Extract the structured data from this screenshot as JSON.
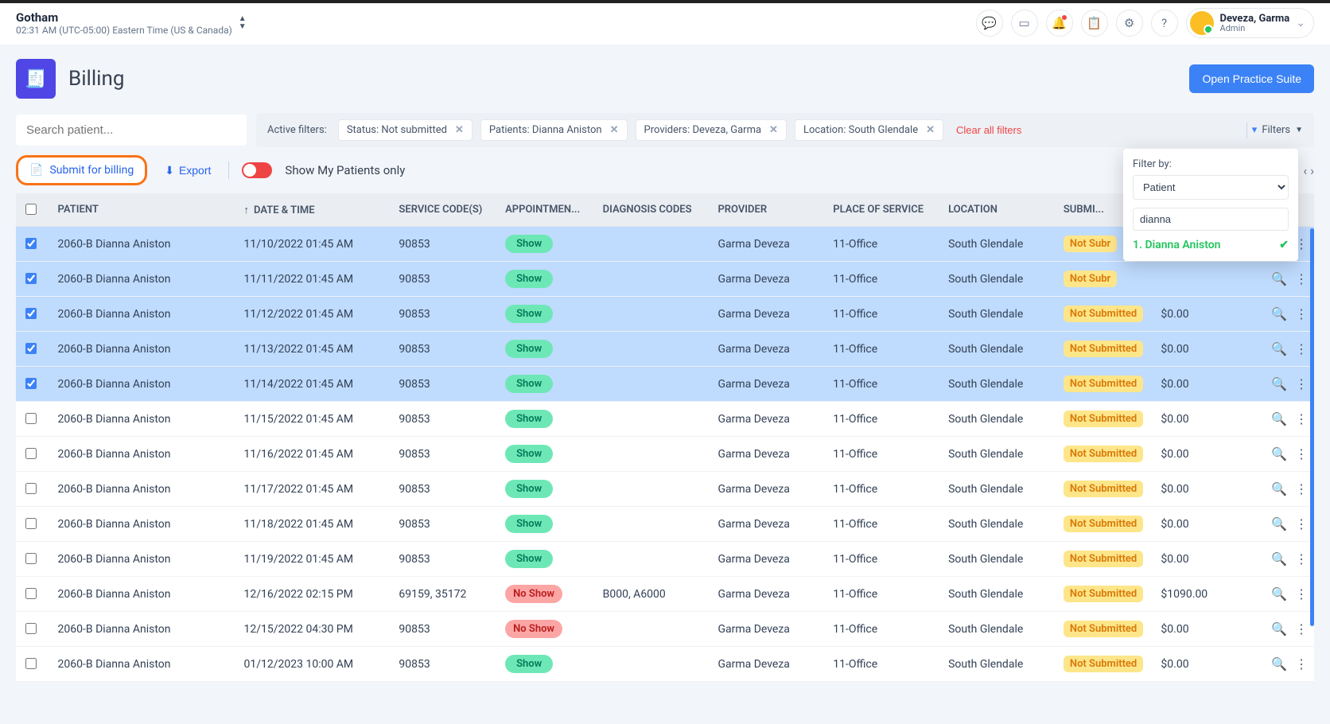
{
  "org": {
    "name": "Gotham",
    "timezone": "02:31 AM (UTC-05:00) Eastern Time (US & Canada)"
  },
  "user": {
    "name": "Deveza, Garma",
    "role": "Admin"
  },
  "page": {
    "title": "Billing",
    "open_suite": "Open Practice Suite"
  },
  "search": {
    "placeholder": "Search patient..."
  },
  "active_filters": {
    "label": "Active filters:",
    "chips": [
      "Status: Not submitted",
      "Patients: Dianna Aniston",
      "Providers: Deveza, Garma",
      "Location: South Glendale"
    ],
    "clear": "Clear all filters",
    "filters_btn": "Filters"
  },
  "toolbar": {
    "submit": "Submit for billing",
    "export": "Export",
    "toggle_label": "Show My Patients only"
  },
  "filter_popover": {
    "title": "Filter by:",
    "field": "Patient",
    "query": "dianna",
    "result": "1. Dianna Aniston"
  },
  "columns": {
    "patient": "PATIENT",
    "datetime": "DATE & TIME",
    "service": "SERVICE CODE(S)",
    "appointment": "APPOINTMEN...",
    "diagnosis": "DIAGNOSIS CODES",
    "provider": "PROVIDER",
    "pos": "PLACE OF SERVICE",
    "location": "LOCATION",
    "submission": "SUBMI..."
  },
  "labels": {
    "show": "Show",
    "noshow": "No Show",
    "not_submitted": "Not Submitted"
  },
  "rows": [
    {
      "selected": true,
      "patient": "2060-B Dianna Aniston",
      "datetime": "11/10/2022 01:45 AM",
      "service": "90853",
      "appt": "show",
      "diag": "",
      "provider": "Garma Deveza",
      "pos": "11-Office",
      "location": "South Glendale",
      "status": "Not Subr",
      "balance": ""
    },
    {
      "selected": true,
      "patient": "2060-B Dianna Aniston",
      "datetime": "11/11/2022 01:45 AM",
      "service": "90853",
      "appt": "show",
      "diag": "",
      "provider": "Garma Deveza",
      "pos": "11-Office",
      "location": "South Glendale",
      "status": "Not Subr",
      "balance": ""
    },
    {
      "selected": true,
      "patient": "2060-B Dianna Aniston",
      "datetime": "11/12/2022 01:45 AM",
      "service": "90853",
      "appt": "show",
      "diag": "",
      "provider": "Garma Deveza",
      "pos": "11-Office",
      "location": "South Glendale",
      "status": "Not Submitted",
      "balance": "$0.00"
    },
    {
      "selected": true,
      "patient": "2060-B Dianna Aniston",
      "datetime": "11/13/2022 01:45 AM",
      "service": "90853",
      "appt": "show",
      "diag": "",
      "provider": "Garma Deveza",
      "pos": "11-Office",
      "location": "South Glendale",
      "status": "Not Submitted",
      "balance": "$0.00"
    },
    {
      "selected": true,
      "patient": "2060-B Dianna Aniston",
      "datetime": "11/14/2022 01:45 AM",
      "service": "90853",
      "appt": "show",
      "diag": "",
      "provider": "Garma Deveza",
      "pos": "11-Office",
      "location": "South Glendale",
      "status": "Not Submitted",
      "balance": "$0.00"
    },
    {
      "selected": false,
      "patient": "2060-B Dianna Aniston",
      "datetime": "11/15/2022 01:45 AM",
      "service": "90853",
      "appt": "show",
      "diag": "",
      "provider": "Garma Deveza",
      "pos": "11-Office",
      "location": "South Glendale",
      "status": "Not Submitted",
      "balance": "$0.00"
    },
    {
      "selected": false,
      "patient": "2060-B Dianna Aniston",
      "datetime": "11/16/2022 01:45 AM",
      "service": "90853",
      "appt": "show",
      "diag": "",
      "provider": "Garma Deveza",
      "pos": "11-Office",
      "location": "South Glendale",
      "status": "Not Submitted",
      "balance": "$0.00"
    },
    {
      "selected": false,
      "patient": "2060-B Dianna Aniston",
      "datetime": "11/17/2022 01:45 AM",
      "service": "90853",
      "appt": "show",
      "diag": "",
      "provider": "Garma Deveza",
      "pos": "11-Office",
      "location": "South Glendale",
      "status": "Not Submitted",
      "balance": "$0.00"
    },
    {
      "selected": false,
      "patient": "2060-B Dianna Aniston",
      "datetime": "11/18/2022 01:45 AM",
      "service": "90853",
      "appt": "show",
      "diag": "",
      "provider": "Garma Deveza",
      "pos": "11-Office",
      "location": "South Glendale",
      "status": "Not Submitted",
      "balance": "$0.00"
    },
    {
      "selected": false,
      "patient": "2060-B Dianna Aniston",
      "datetime": "11/19/2022 01:45 AM",
      "service": "90853",
      "appt": "show",
      "diag": "",
      "provider": "Garma Deveza",
      "pos": "11-Office",
      "location": "South Glendale",
      "status": "Not Submitted",
      "balance": "$0.00"
    },
    {
      "selected": false,
      "patient": "2060-B Dianna Aniston",
      "datetime": "12/16/2022 02:15 PM",
      "service": "69159, 35172",
      "appt": "noshow",
      "diag": "B000, A6000",
      "provider": "Garma Deveza",
      "pos": "11-Office",
      "location": "South Glendale",
      "status": "Not Submitted",
      "balance": "$1090.00"
    },
    {
      "selected": false,
      "patient": "2060-B Dianna Aniston",
      "datetime": "12/15/2022 04:30 PM",
      "service": "90853",
      "appt": "noshow",
      "diag": "",
      "provider": "Garma Deveza",
      "pos": "11-Office",
      "location": "South Glendale",
      "status": "Not Submitted",
      "balance": "$0.00"
    },
    {
      "selected": false,
      "patient": "2060-B Dianna Aniston",
      "datetime": "01/12/2023 10:00 AM",
      "service": "90853",
      "appt": "show",
      "diag": "",
      "provider": "Garma Deveza",
      "pos": "11-Office",
      "location": "South Glendale",
      "status": "Not Submitted",
      "balance": "$0.00"
    }
  ]
}
